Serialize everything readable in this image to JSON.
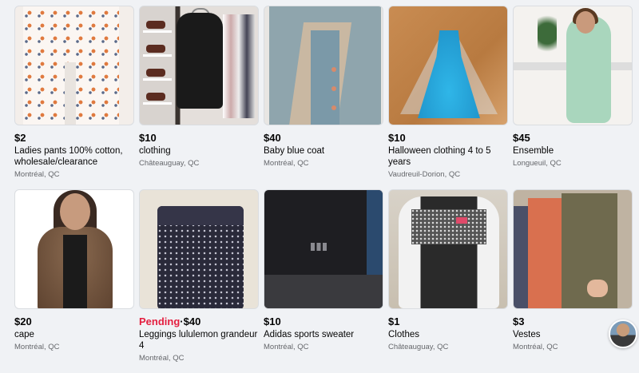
{
  "listings": [
    {
      "price": "$2",
      "title": "Ladies pants 100% cotton, wholesale/clearance",
      "location": "Montréal, QC"
    },
    {
      "price": "$10",
      "title": "clothing",
      "location": "Châteauguay, QC"
    },
    {
      "price": "$40",
      "title": "Baby blue coat",
      "location": "Montréal, QC"
    },
    {
      "price": "$10",
      "title": "Halloween clothing 4 to 5 years",
      "location": "Vaudreuil-Dorion, QC"
    },
    {
      "price": "$45",
      "title": "Ensemble",
      "location": "Longueuil, QC"
    },
    {
      "price": "$20",
      "title": "cape",
      "location": "Montréal, QC"
    },
    {
      "status": "Pending",
      "separator": "·",
      "price": "$40",
      "title": "Leggings lululemon grandeur 4",
      "location": "Montréal, QC"
    },
    {
      "price": "$10",
      "title": "Adidas sports sweater",
      "location": "Montréal, QC"
    },
    {
      "price": "$1",
      "title": "Clothes",
      "location": "Châteauguay, QC"
    },
    {
      "price": "$3",
      "title": "Vestes",
      "location": "Montréal, QC"
    }
  ],
  "colors": {
    "pending": "#e41e3f",
    "secondary_text": "#65676b",
    "background": "#f0f2f5"
  }
}
